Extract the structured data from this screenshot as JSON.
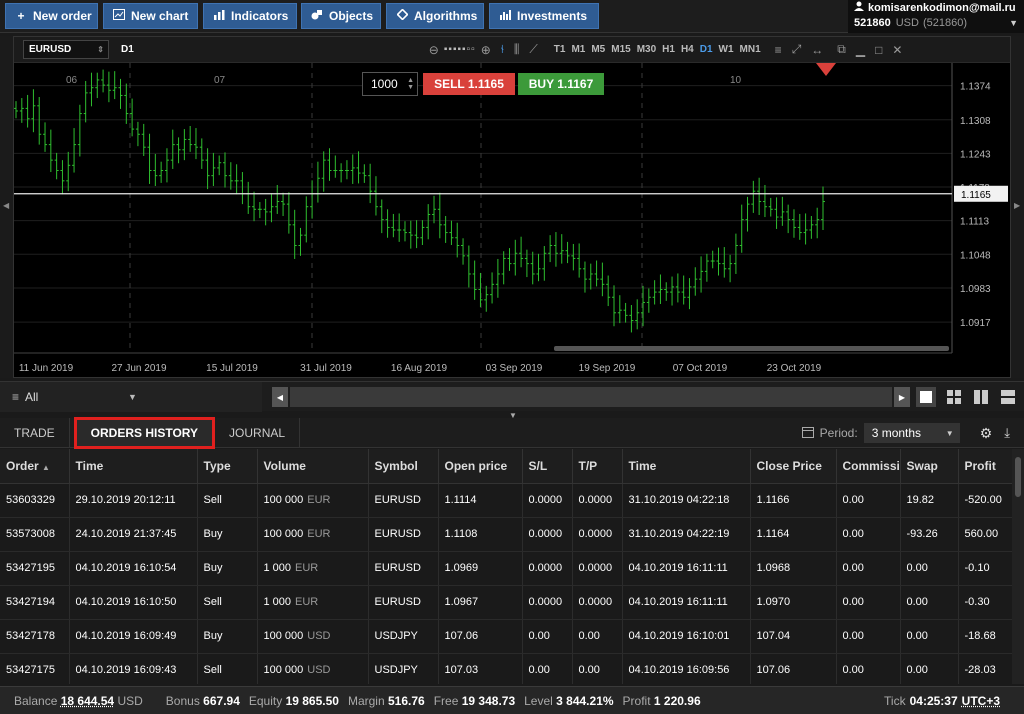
{
  "toolbar": {
    "buttons": [
      {
        "label": "New order",
        "icon": "+"
      },
      {
        "label": "New chart",
        "icon": "chart-icon"
      },
      {
        "label": "Indicators",
        "icon": "indicators-icon"
      },
      {
        "label": "Objects",
        "icon": "objects-icon"
      },
      {
        "label": "Algorithms",
        "icon": "algorithms-icon"
      },
      {
        "label": "Investments",
        "icon": "investments-icon"
      }
    ]
  },
  "account": {
    "email": "komisarenkodimon@mail.ru",
    "id": "521860",
    "currency": "USD",
    "id_paren": "(521860)"
  },
  "chart": {
    "symbol": "EURUSD",
    "timeframe_label": "D1",
    "timeframes": [
      "T1",
      "M1",
      "M5",
      "M15",
      "M30",
      "H1",
      "H4",
      "D1",
      "W1",
      "MN1"
    ],
    "active_timeframe": "D1",
    "quantity": "1000",
    "sell_label": "SELL 1.1165",
    "buy_label": "BUY 1.1167",
    "current_price": "1.1165",
    "colors": {
      "sell": "#d9413b",
      "buy": "#3c9a3a",
      "candle": "#2fbf2f",
      "accent": "#2f5c93"
    }
  },
  "chart_data": {
    "type": "ohlc",
    "symbol": "EURUSD",
    "timeframe": "D1",
    "y_ticks": [
      1.1374,
      1.1308,
      1.1243,
      1.1178,
      1.1113,
      1.1048,
      1.0983,
      1.0917
    ],
    "ylim": [
      1.0865,
      1.141
    ],
    "x_ticks": [
      "11 Jun 2019",
      "27 Jun 2019",
      "15 Jul 2019",
      "31 Jul 2019",
      "16 Aug 2019",
      "03 Sep 2019",
      "19 Sep 2019",
      "07 Oct 2019",
      "23 Oct 2019"
    ],
    "top_labels": [
      "06",
      "07",
      "10"
    ],
    "current_price": 1.1165,
    "closes": [
      1.1325,
      1.133,
      1.131,
      1.1335,
      1.128,
      1.126,
      1.123,
      1.121,
      1.119,
      1.122,
      1.126,
      1.132,
      1.136,
      1.137,
      1.1385,
      1.1375,
      1.1365,
      1.137,
      1.1355,
      1.132,
      1.129,
      1.128,
      1.1255,
      1.121,
      1.12,
      1.121,
      1.123,
      1.126,
      1.125,
      1.127,
      1.126,
      1.1255,
      1.123,
      1.12,
      1.1215,
      1.1225,
      1.12,
      1.119,
      1.119,
      1.1165,
      1.114,
      1.1135,
      1.1135,
      1.113,
      1.114,
      1.115,
      1.1145,
      1.1105,
      1.1065,
      1.1085,
      1.114,
      1.1165,
      1.1195,
      1.123,
      1.121,
      1.121,
      1.121,
      1.121,
      1.1215,
      1.1205,
      1.12,
      1.117,
      1.114,
      1.1115,
      1.11,
      1.1095,
      1.1095,
      1.109,
      1.1085,
      1.108,
      1.11,
      1.1125,
      1.1135,
      1.1105,
      1.109,
      1.108,
      1.1065,
      1.1045,
      1.101,
      1.098,
      1.096,
      1.097,
      1.099,
      1.101,
      1.104,
      1.103,
      1.105,
      1.104,
      1.103,
      1.101,
      1.102,
      1.105,
      1.1065,
      1.105,
      1.1055,
      1.1045,
      1.104,
      1.102,
      1.1,
      1.101,
      1.1,
      1.099,
      1.0965,
      1.0935,
      1.094,
      1.093,
      1.092,
      1.0935,
      1.0955,
      1.0965,
      1.0975,
      1.098,
      1.0975,
      1.0985,
      1.0975,
      1.0965,
      1.0985,
      1.1,
      1.1015,
      1.1035,
      1.1035,
      1.103,
      1.102,
      1.103,
      1.1065,
      1.1115,
      1.1145,
      1.117,
      1.115,
      1.114,
      1.1135,
      1.112,
      1.113,
      1.1115,
      1.11,
      1.109,
      1.1095,
      1.1105,
      1.1115,
      1.115
    ]
  },
  "strip": {
    "filter_label": "All"
  },
  "tabs": {
    "trade": "TRADE",
    "orders_history": "ORDERS HISTORY",
    "journal": "JOURNAL",
    "period_label": "Period:",
    "period_value": "3 months"
  },
  "table": {
    "headers": [
      "Order",
      "Time",
      "Type",
      "Volume",
      "Symbol",
      "Open price",
      "S/L",
      "T/P",
      "Time",
      "Close Price",
      "Commissi",
      "Swap",
      "Profit"
    ],
    "sort_indicator": "▲",
    "rows": [
      {
        "order": "53603329",
        "time": "29.10.2019 20:12:11",
        "type": "Sell",
        "volume": "100 000",
        "vccy": "EUR",
        "symbol": "EURUSD",
        "open": "1.1114",
        "sl": "0.0000",
        "tp": "0.0000",
        "ctime": "31.10.2019 04:22:18",
        "close": "1.1166",
        "comm": "0.00",
        "swap": "19.82",
        "profit": "-520.00"
      },
      {
        "order": "53573008",
        "time": "24.10.2019 21:37:45",
        "type": "Buy",
        "volume": "100 000",
        "vccy": "EUR",
        "symbol": "EURUSD",
        "open": "1.1108",
        "sl": "0.0000",
        "tp": "0.0000",
        "ctime": "31.10.2019 04:22:19",
        "close": "1.1164",
        "comm": "0.00",
        "swap": "-93.26",
        "profit": "560.00"
      },
      {
        "order": "53427195",
        "time": "04.10.2019 16:10:54",
        "type": "Buy",
        "volume": "1 000",
        "vccy": "EUR",
        "symbol": "EURUSD",
        "open": "1.0969",
        "sl": "0.0000",
        "tp": "0.0000",
        "ctime": "04.10.2019 16:11:11",
        "close": "1.0968",
        "comm": "0.00",
        "swap": "0.00",
        "profit": "-0.10"
      },
      {
        "order": "53427194",
        "time": "04.10.2019 16:10:50",
        "type": "Sell",
        "volume": "1 000",
        "vccy": "EUR",
        "symbol": "EURUSD",
        "open": "1.0967",
        "sl": "0.0000",
        "tp": "0.0000",
        "ctime": "04.10.2019 16:11:11",
        "close": "1.0970",
        "comm": "0.00",
        "swap": "0.00",
        "profit": "-0.30"
      },
      {
        "order": "53427178",
        "time": "04.10.2019 16:09:49",
        "type": "Buy",
        "volume": "100 000",
        "vccy": "USD",
        "symbol": "USDJPY",
        "open": "107.06",
        "sl": "0.00",
        "tp": "0.00",
        "ctime": "04.10.2019 16:10:01",
        "close": "107.04",
        "comm": "0.00",
        "swap": "0.00",
        "profit": "-18.68"
      },
      {
        "order": "53427175",
        "time": "04.10.2019 16:09:43",
        "type": "Sell",
        "volume": "100 000",
        "vccy": "USD",
        "symbol": "USDJPY",
        "open": "107.03",
        "sl": "0.00",
        "tp": "0.00",
        "ctime": "04.10.2019 16:09:56",
        "close": "107.06",
        "comm": "0.00",
        "swap": "0.00",
        "profit": "-28.03"
      }
    ]
  },
  "status": {
    "balance_label": "Balance",
    "balance": "18 644.54",
    "balance_ccy": "USD",
    "bonus_label": "Bonus",
    "bonus": "667.94",
    "equity_label": "Equity",
    "equity": "19 865.50",
    "margin_label": "Margin",
    "margin": "516.76",
    "free_label": "Free",
    "free": "19 348.73",
    "level_label": "Level",
    "level": "3 844.21%",
    "profit_label": "Profit",
    "profit": "1 220.96",
    "tick_label": "Tick",
    "tick_time": "04:25:37",
    "tz": "UTC+3"
  }
}
